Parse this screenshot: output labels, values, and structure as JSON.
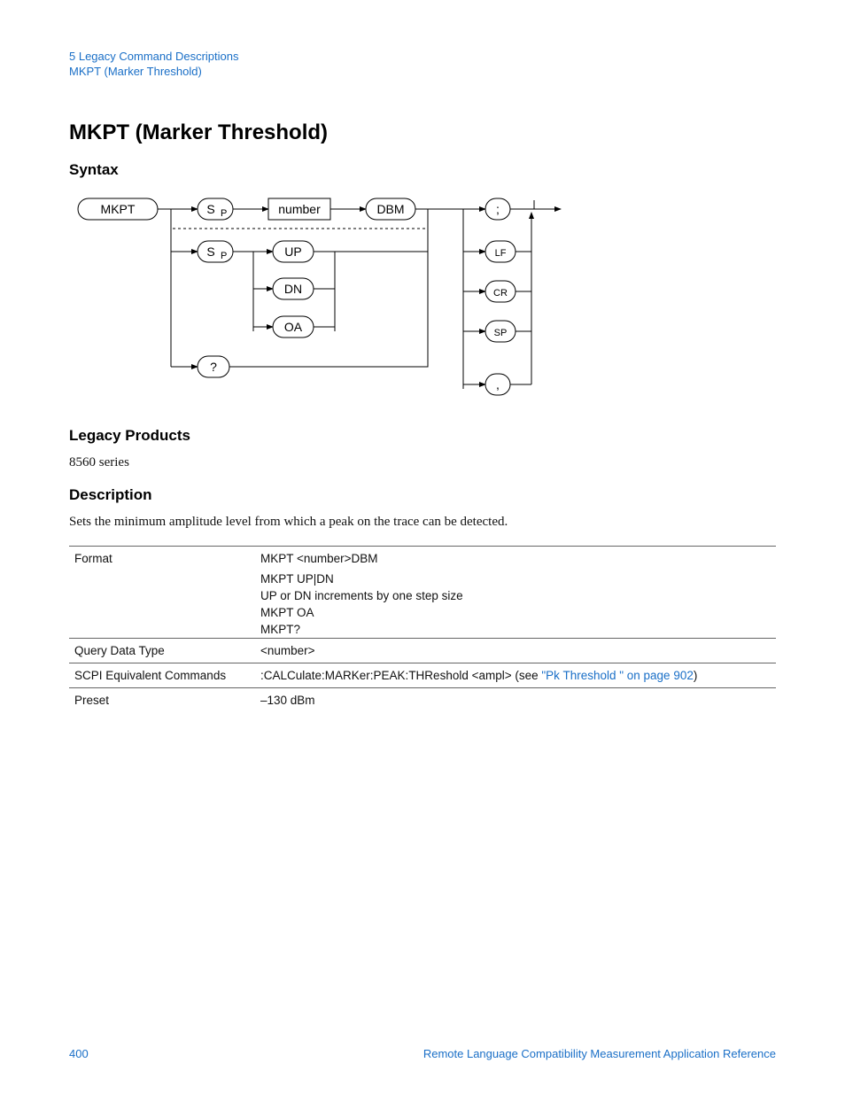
{
  "header": {
    "line1": "5  Legacy Command Descriptions",
    "line2": "MKPT (Marker Threshold)"
  },
  "title": "MKPT (Marker Threshold)",
  "sections": {
    "syntax": "Syntax",
    "legacy_products": "Legacy Products",
    "description": "Description"
  },
  "legacy_products_text": "8560 series",
  "description_text": "Sets the minimum amplitude level from which a peak on the trace can be detected.",
  "diagram": {
    "mkpt": "MKPT",
    "sp1": "S",
    "sp1_sub": "P",
    "number": "number",
    "dbm": "DBM",
    "semicolon": ";",
    "sp2": "S",
    "sp2_sub": "P",
    "up": "UP",
    "dn": "DN",
    "oa": "OA",
    "q": "?",
    "lf": "LF",
    "cr": "CR",
    "spterm": "SP",
    "comma": ","
  },
  "table": {
    "rows": [
      {
        "label": "Format",
        "value": "MKPT <number>DBM"
      },
      {
        "label": "",
        "value": "MKPT UP|DN"
      },
      {
        "label": "",
        "value": "UP or DN increments by one step size"
      },
      {
        "label": "",
        "value": "MKPT OA"
      },
      {
        "label": "",
        "value": "MKPT?"
      },
      {
        "label": "Query Data Type",
        "value": "<number>"
      },
      {
        "label": "SCPI Equivalent Commands",
        "value_prefix": ":CALCulate:MARKer:PEAK:THReshold <ampl> (see ",
        "link": "\"Pk Threshold \" on page 902",
        "value_suffix": ")"
      },
      {
        "label": "Preset",
        "value": "–130 dBm"
      }
    ]
  },
  "footer": {
    "page": "400",
    "ref": "Remote Language Compatibility Measurement Application Reference"
  }
}
